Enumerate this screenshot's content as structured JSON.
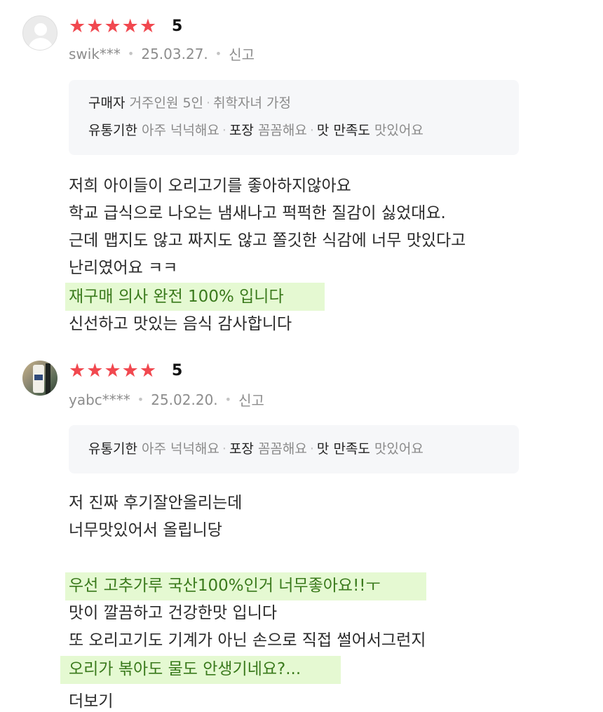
{
  "reviews": [
    {
      "rating": "5",
      "user": "swik***",
      "date": "25.03.27.",
      "report_label": "신고",
      "buyer_info": {
        "label": "구매자",
        "household": "거주인원 5인",
        "family": "취학자녀 가정"
      },
      "attributes": [
        {
          "key": "유통기한",
          "value": "아주 넉넉해요"
        },
        {
          "key": "포장",
          "value": "꼼꼼해요"
        },
        {
          "key": "맛 만족도",
          "value": "맛있어요"
        }
      ],
      "lines": [
        "저희 아이들이 오리고기를 좋아하지않아요",
        "학교 급식으로 나오는 냄새나고 퍽퍽한 질감이 싫었대요.",
        "근데 맵지도 않고 짜지도 않고 쫄깃한 식감에 너무 맛있다고",
        "난리였어요 ㅋㅋ",
        "재구매 의사 완전 100% 입니다",
        "신선하고 맛있는 음식 감사합니다"
      ]
    },
    {
      "rating": "5",
      "user": "yabc****",
      "date": "25.02.20.",
      "report_label": "신고",
      "attributes": [
        {
          "key": "유통기한",
          "value": "아주 넉넉해요"
        },
        {
          "key": "포장",
          "value": "꼼꼼해요"
        },
        {
          "key": "맛 만족도",
          "value": "맛있어요"
        }
      ],
      "lines": [
        "저 진짜 후기잘안올리는데",
        "너무맛있어서 올립니당",
        "우선 고추가루 국산100%인거 너무좋아요!!ㅜ",
        "맛이 깔끔하고 건강한맛 입니다",
        "또 오리고기도 기계가 아닌 손으로 직접 썰어서그런지",
        "오리가 볶아도 물도 안생기네요?...",
        "더보기"
      ]
    }
  ],
  "colors": {
    "star": "#f1484f",
    "highlight_bg": "#e5f9d2",
    "info_bg": "#f6f7f9"
  }
}
